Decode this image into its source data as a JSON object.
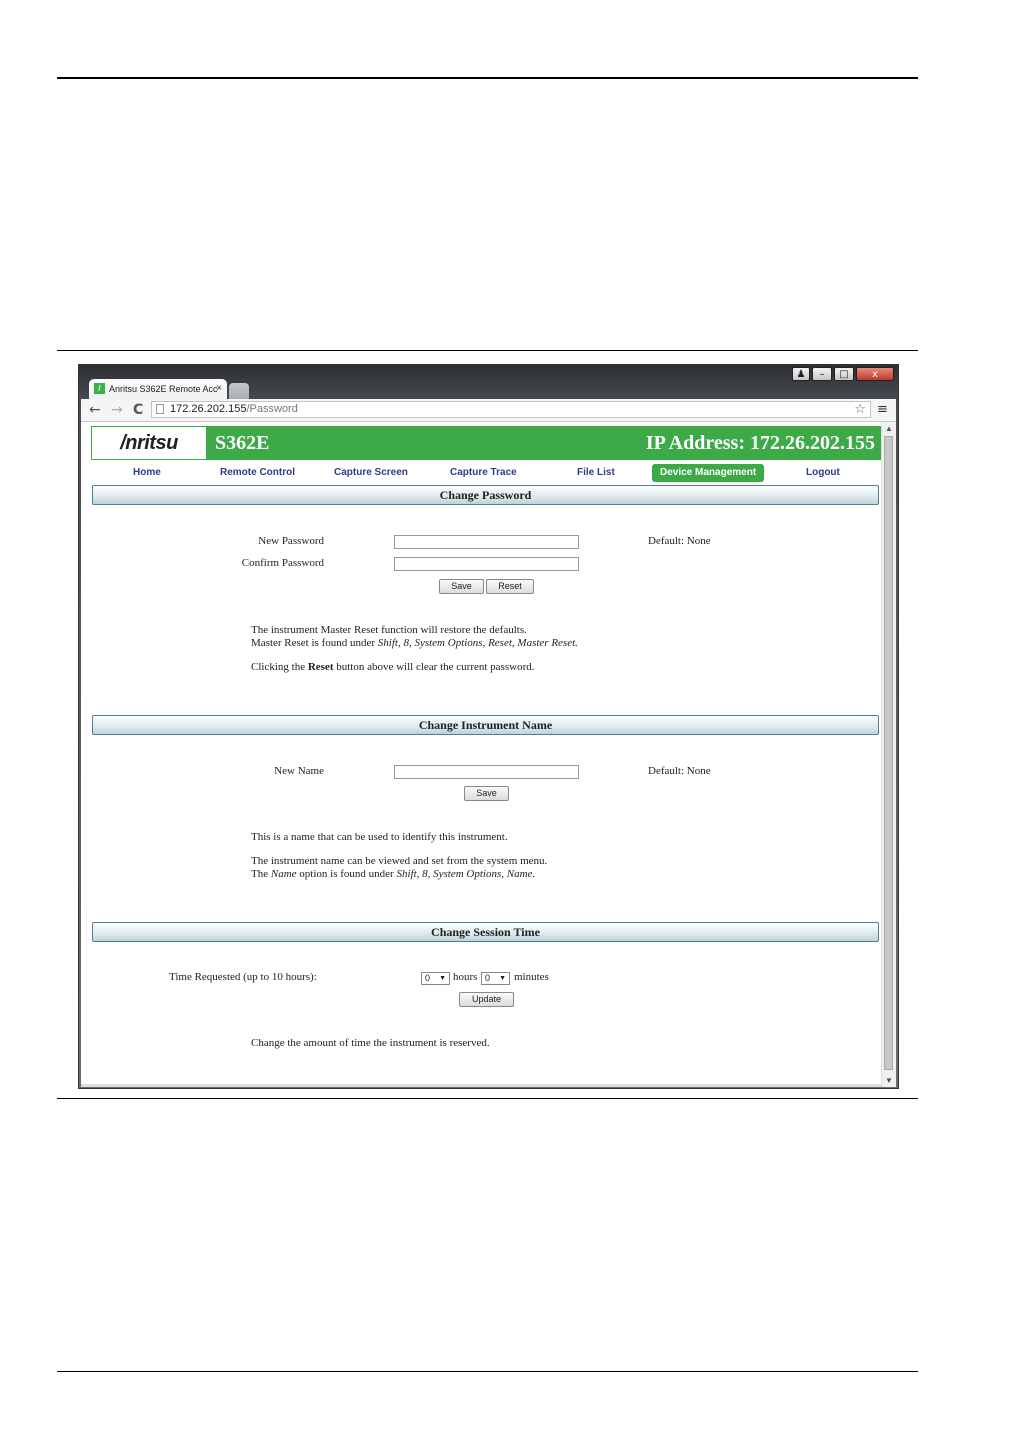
{
  "browser": {
    "tab_title": "Anritsu S362E Remote Acc",
    "tab_close": "×",
    "url_host": "172.26.202.155",
    "url_path": "/Password",
    "back": "←",
    "forward": "→",
    "reload": "C",
    "star": "☆",
    "menu": "≡",
    "win_min": "–",
    "win_max": "□",
    "win_close": "x"
  },
  "header": {
    "logo": "/nritsu",
    "model": "S362E",
    "ip": "IP Address: 172.26.202.155"
  },
  "nav": {
    "items": [
      "Home",
      "Remote Control",
      "Capture Screen",
      "Capture Trace",
      "File List",
      "Device Management",
      "Logout"
    ],
    "active": "Device Management"
  },
  "password": {
    "title": "Change Password",
    "new_label": "New Password",
    "confirm_label": "Confirm Password",
    "default": "Default: None",
    "save": "Save",
    "reset": "Reset",
    "info1": "The instrument Master Reset function will restore the defaults.",
    "info2_prefix": "Master Reset is found under ",
    "info2_path": "Shift, 8, System Options, Reset, Master Reset.",
    "info3_prefix": "Clicking the ",
    "info3_bold": "Reset",
    "info3_suffix": " button above will clear the current password."
  },
  "name": {
    "title": "Change Instrument Name",
    "new_label": "New Name",
    "default": "Default: None",
    "save": "Save",
    "info1": "This is a name that can be used to identify this instrument.",
    "info2": "The instrument name can be viewed and set from the system menu.",
    "info3_prefix": "The ",
    "info3_name": "Name",
    "info3_mid": " option is found under ",
    "info3_path": "Shift, 8, System Options, Name."
  },
  "session": {
    "title": "Change Session Time",
    "label": "Time Requested (up to 10 hours):",
    "hours_value": "0",
    "hours_label": "hours",
    "minutes_value": "0",
    "minutes_label": "minutes",
    "update": "Update",
    "info": "Change the amount of time the instrument is reserved."
  }
}
